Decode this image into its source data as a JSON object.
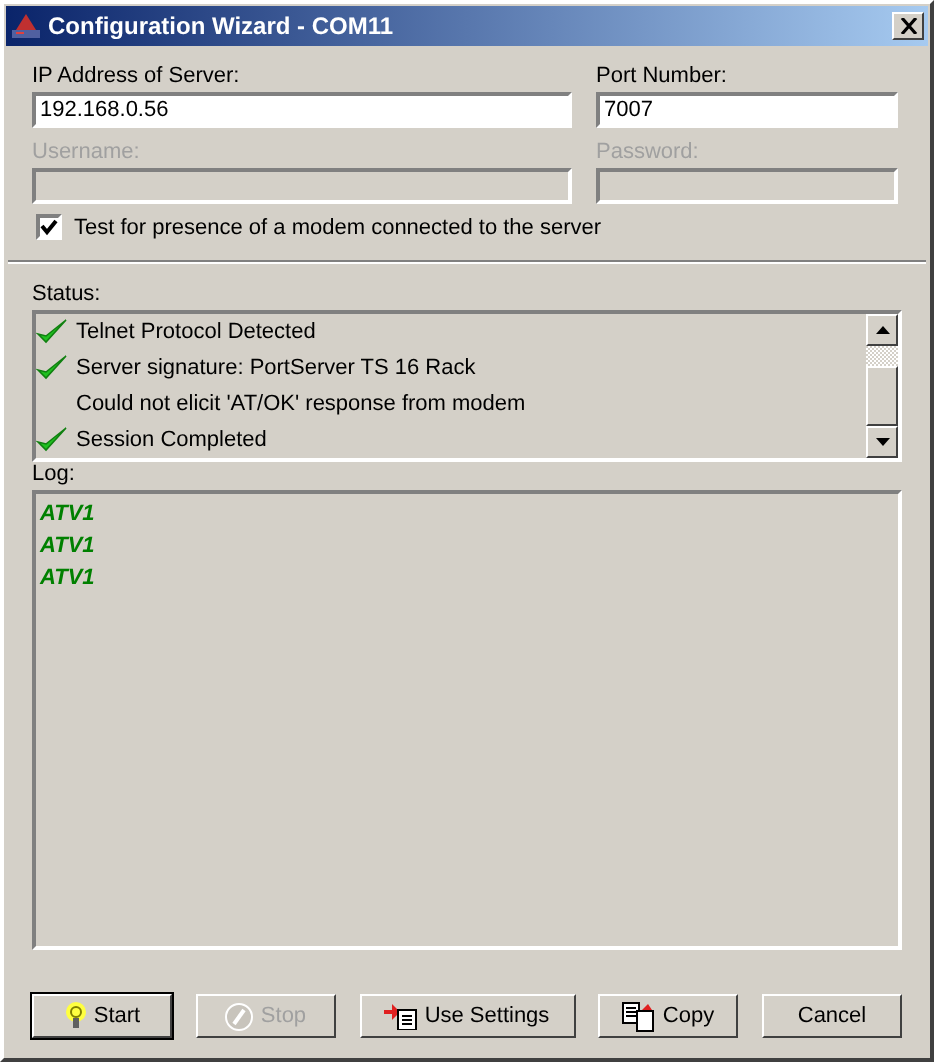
{
  "window": {
    "title": "Configuration Wizard - COM11"
  },
  "fields": [
    {
      "label": "IP Address of Server:",
      "value": "192.168.0.56",
      "disabled": false
    },
    {
      "label": "Port Number:",
      "value": "7007",
      "disabled": false
    },
    {
      "label": "Username:",
      "disabled": true
    },
    {
      "label": "Password:",
      "disabled": true
    }
  ],
  "modem_test": {
    "label": "Test for presence of a modem connected to the server",
    "checked": true
  },
  "status": {
    "label": "Status:",
    "items": [
      {
        "kind": "success",
        "text": "Telnet Protocol Detected"
      },
      {
        "kind": "success",
        "text": "Server signature: PortServer TS 16 Rack"
      },
      {
        "kind": "plain",
        "text": "Could not elicit 'AT/OK' response from modem"
      },
      {
        "kind": "success",
        "text": "Session Completed"
      }
    ]
  },
  "log": {
    "label": "Log:",
    "lines": [
      "ATV1",
      "ATV1",
      "ATV1"
    ]
  },
  "buttons": [
    {
      "kind": "start",
      "label": "Start",
      "disabled": false,
      "default": true
    },
    {
      "kind": "stop",
      "label": "Stop",
      "disabled": true,
      "default": false
    },
    {
      "kind": "use-settings",
      "label": "Use Settings",
      "disabled": false,
      "default": false
    },
    {
      "kind": "copy",
      "label": "Copy",
      "disabled": false,
      "default": false
    },
    {
      "kind": "cancel",
      "label": "Cancel",
      "disabled": false,
      "default": false
    }
  ]
}
